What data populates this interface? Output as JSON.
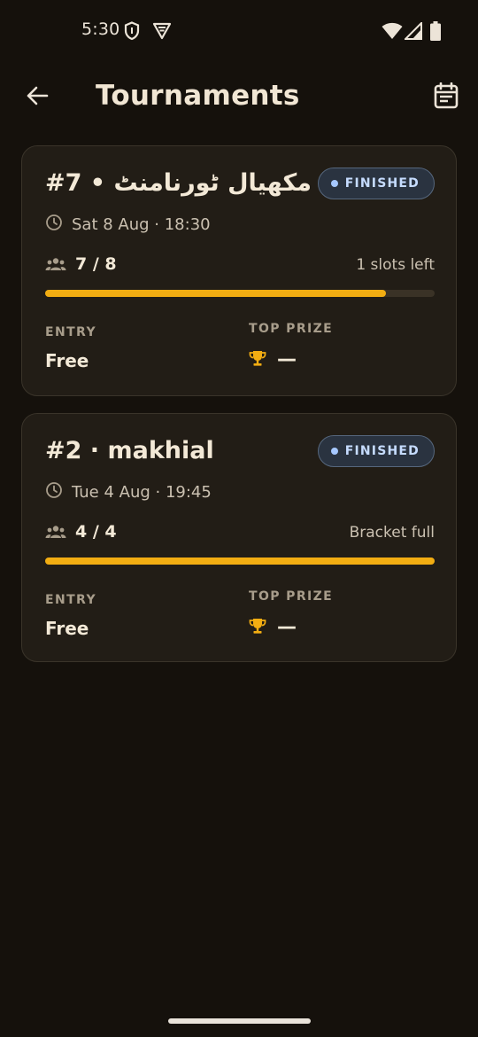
{
  "status_bar": {
    "time": "5:30",
    "icons": [
      "shield-icon",
      "vpn-icon",
      "wifi-icon",
      "signal-icon",
      "battery-icon"
    ]
  },
  "app_bar": {
    "title": "Tournaments",
    "back_icon": "arrow-back-icon",
    "action_icon": "calendar-event-icon"
  },
  "tournaments": [
    {
      "title": "#7 • مکھیال ٹورنامنٹ",
      "status": "FINISHED",
      "date": "Sat 8 Aug · 18:30",
      "players": "7 / 8",
      "fill_fraction": 0.875,
      "slots_text": "1 slots left",
      "entry_label": "ENTRY",
      "entry_value": "Free",
      "prize_label": "TOP PRIZE",
      "prize_value": "—"
    },
    {
      "title": "#2 · makhial",
      "status": "FINISHED",
      "date": "Tue 4 Aug · 19:45",
      "players": "4 / 4",
      "fill_fraction": 1.0,
      "slots_text": "Bracket full",
      "entry_label": "ENTRY",
      "entry_value": "Free",
      "prize_label": "TOP PRIZE",
      "prize_value": "—"
    }
  ],
  "colors": {
    "background": "#15110c",
    "card": "#221d16",
    "accent": "#f2ad12",
    "badge_text": "#c6dcff"
  }
}
